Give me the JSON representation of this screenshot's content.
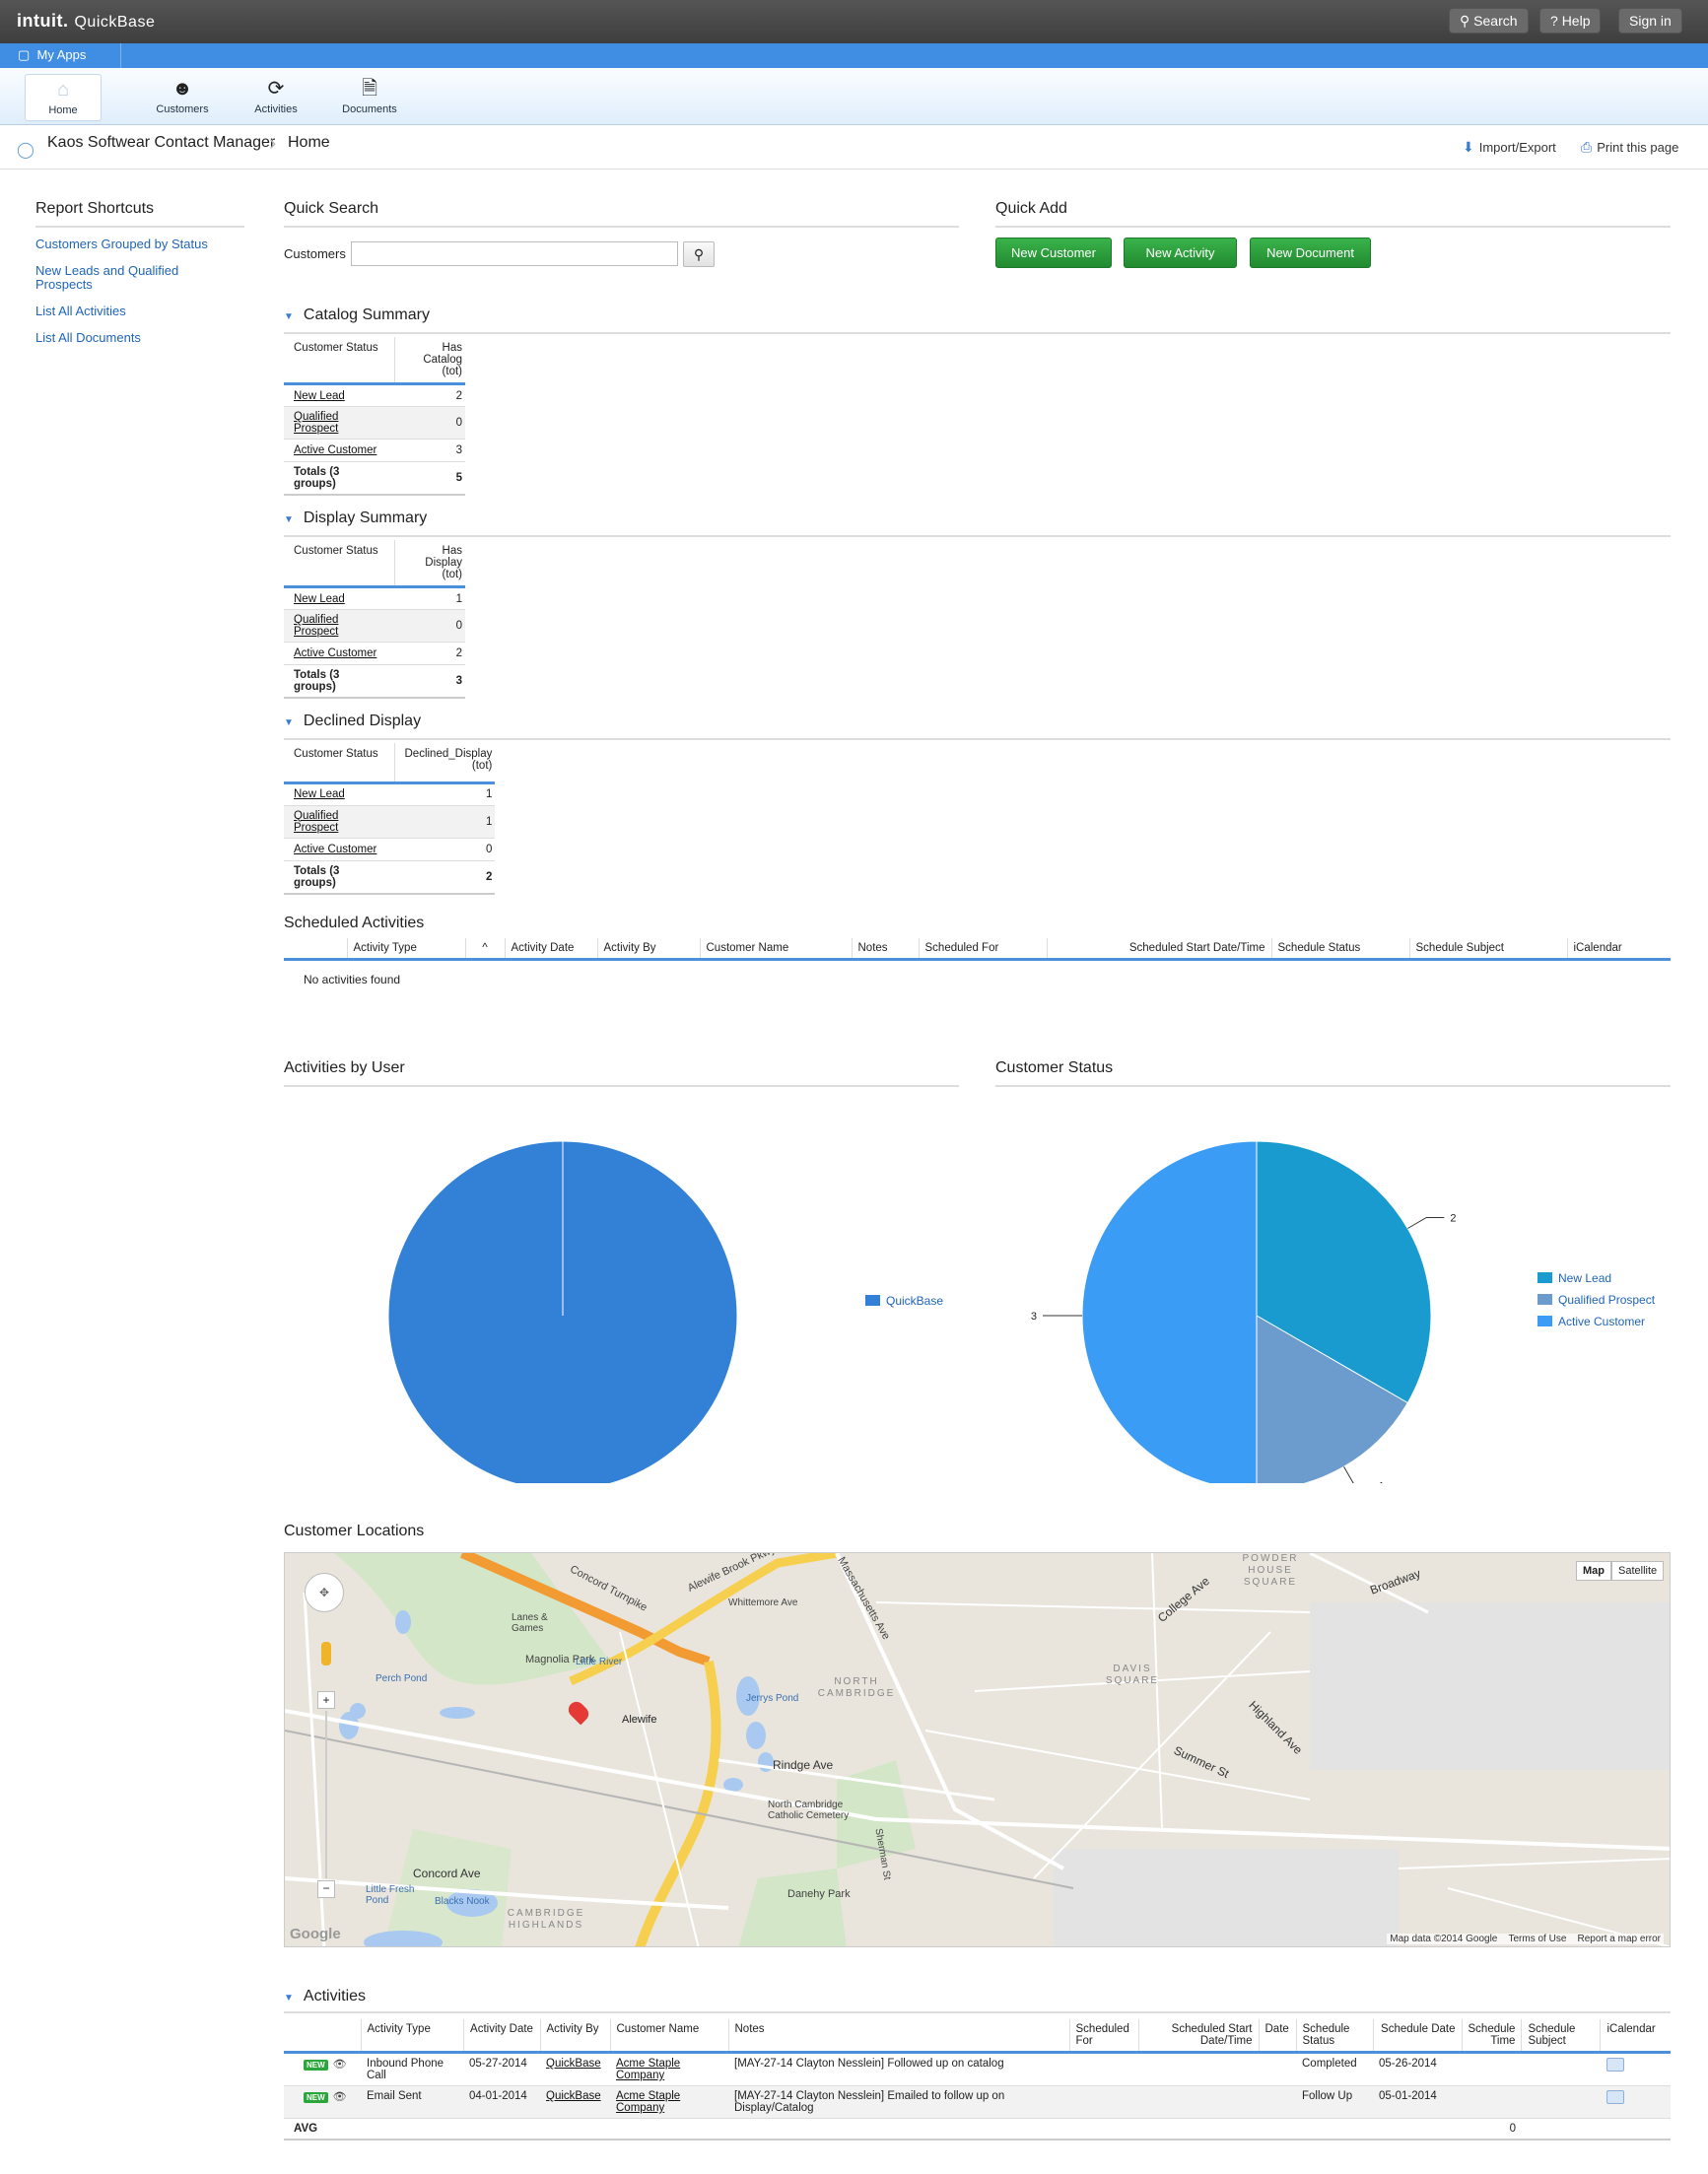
{
  "header": {
    "logo": "intuit.",
    "product": "QuickBase",
    "search": "Search",
    "help": "Help",
    "signin": "Sign in"
  },
  "apps_bar": {
    "my_apps": "My Apps"
  },
  "nav": {
    "home": "Home",
    "customers": "Customers",
    "activities": "Activities",
    "documents": "Documents"
  },
  "breadcrumb": {
    "app": "Kaos Softwear Contact Manager",
    "page": "Home",
    "import_export": "Import/Export",
    "print": "Print this page"
  },
  "sidebar": {
    "title": "Report Shortcuts",
    "items": [
      "Customers Grouped by Status",
      "New Leads and Qualified Prospects",
      "List All Activities",
      "List All Documents"
    ]
  },
  "quick_search": {
    "title": "Quick Search",
    "label": "Customers",
    "value": ""
  },
  "quick_add": {
    "title": "Quick Add",
    "new_customer": "New Customer",
    "new_activity": "New Activity",
    "new_document": "New Document"
  },
  "catalog_summary": {
    "title": "Catalog Summary",
    "col1": "Customer Status",
    "col2a": "Has Catalog",
    "col2b": "(tot)",
    "rows": [
      {
        "status": "New Lead",
        "value": "2"
      },
      {
        "status": "Qualified Prospect",
        "value": "0"
      },
      {
        "status": "Active Customer",
        "value": "3"
      }
    ],
    "total_label": "Totals (3 groups)",
    "total": "5"
  },
  "display_summary": {
    "title": "Display Summary",
    "col1": "Customer Status",
    "col2a": "Has Display",
    "col2b": "(tot)",
    "rows": [
      {
        "status": "New Lead",
        "value": "1"
      },
      {
        "status": "Qualified Prospect",
        "value": "0"
      },
      {
        "status": "Active Customer",
        "value": "2"
      }
    ],
    "total_label": "Totals (3 groups)",
    "total": "3"
  },
  "declined_display": {
    "title": "Declined Display",
    "col1": "Customer Status",
    "col2a": "Declined_Display",
    "col2b": "(tot)",
    "rows": [
      {
        "status": "New Lead",
        "value": "1"
      },
      {
        "status": "Qualified Prospect",
        "value": "1"
      },
      {
        "status": "Active Customer",
        "value": "0"
      }
    ],
    "total_label": "Totals (3 groups)",
    "total": "2"
  },
  "scheduled_activities": {
    "title": "Scheduled Activities",
    "columns": [
      "Activity Type",
      "Activity Date",
      "Activity By",
      "Customer Name",
      "Notes",
      "Scheduled For",
      "Scheduled Start Date/Time",
      "Schedule Status",
      "Schedule Subject",
      "iCalendar"
    ],
    "sort_icon": "^",
    "empty": "No activities found"
  },
  "activities_by_user": {
    "title": "Activities by User"
  },
  "customer_status_chart": {
    "title": "Customer Status"
  },
  "chart_data": [
    {
      "type": "pie",
      "title": "Activities by User",
      "labels": [
        "QuickBase"
      ],
      "values": [
        1
      ],
      "colors": [
        "#3281d6"
      ]
    },
    {
      "type": "pie",
      "title": "Customer Status",
      "labels": [
        "New Lead",
        "Qualified Prospect",
        "Active Customer"
      ],
      "values": [
        2,
        1,
        3
      ],
      "colors": [
        "#1a9bd0",
        "#6b9ccd",
        "#3b9cf5"
      ]
    }
  ],
  "customer_locations": {
    "title": "Customer Locations",
    "map_btn": "Map",
    "satellite_btn": "Satellite",
    "labels": {
      "magnolia": "Magnolia Park",
      "lanes": "Lanes & Games",
      "concord_tpk": "Concord Turnpike",
      "alewife_pkwy": "Alewife Brook Pkwy",
      "alewife": "Alewife",
      "north_cambridge": "NORTH CAMBRIDGE",
      "davis": "DAVIS SQUARE",
      "powder_house": "POWDER HOUSE SQUARE",
      "rindge": "Rindge Ave",
      "mass_ave": "Massachusetts Ave",
      "concord_ave": "Concord Ave",
      "danehy": "Danehy Park",
      "cemetery": "North Cambridge Catholic Cemetery",
      "highlands": "CAMBRIDGE HIGHLANDS",
      "perch": "Perch Pond",
      "little_fresh": "Little Fresh Pond",
      "blacks_nook": "Blacks Nook",
      "jerrys": "Jerrys Pond",
      "summer": "Summer St",
      "highland_ave": "Highland Ave",
      "college": "College Ave",
      "broadway": "Broadway",
      "whittemore": "Whittemore Ave",
      "sherman": "Sherman St",
      "little_river": "Little River",
      "google": "Google"
    },
    "footer": {
      "data": "Map data ©2014 Google",
      "terms": "Terms of Use",
      "report": "Report a map error"
    }
  },
  "activities": {
    "title": "Activities",
    "columns": [
      "Activity Type",
      "Activity Date",
      "Activity By",
      "Customer Name",
      "Notes",
      "Scheduled For",
      "Scheduled Start Date/Time",
      "Date",
      "Schedule Status",
      "Schedule Date",
      "Schedule Time",
      "Schedule Subject",
      "iCalendar"
    ],
    "badge": "NEW",
    "rows": [
      {
        "type": "Inbound Phone Call",
        "date": "05-27-2014",
        "by": "QuickBase",
        "customer": "Acme Staple Company",
        "notes": "[MAY-27-14 Clayton Nesslein] Followed up on catalog",
        "status": "Completed",
        "sched_date": "05-26-2014"
      },
      {
        "type": "Email Sent",
        "date": "04-01-2014",
        "by": "QuickBase",
        "customer": "Acme Staple Company",
        "notes": "[MAY-27-14 Clayton Nesslein] Emailed to follow up on Display/Catalog",
        "status": "Follow Up",
        "sched_date": "05-01-2014"
      }
    ],
    "avg_label": "AVG",
    "avg_value": "0"
  }
}
